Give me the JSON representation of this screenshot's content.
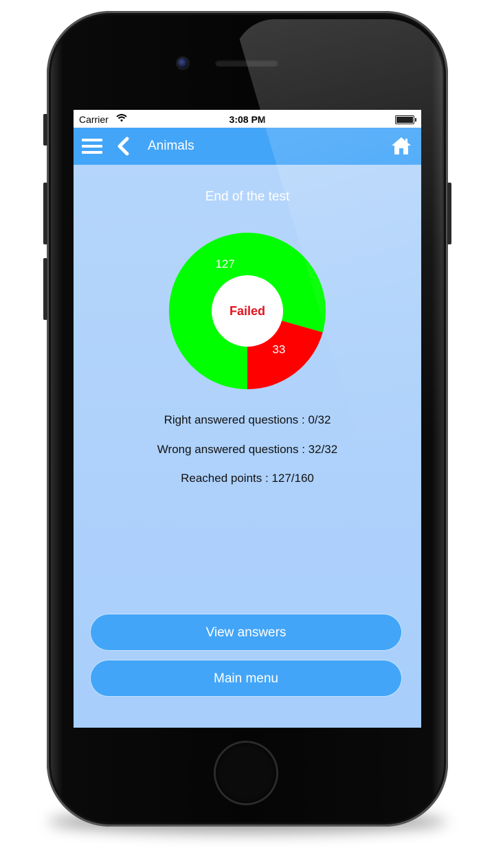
{
  "status_bar": {
    "carrier": "Carrier",
    "time": "3:08 PM"
  },
  "nav": {
    "title": "Animals",
    "icons": [
      "menu-icon",
      "back-icon",
      "home-icon"
    ]
  },
  "content": {
    "heading": "End of the test",
    "result_label": "Failed",
    "stats": {
      "right": "Right answered questions : 0/32",
      "wrong": "Wrong  answered questions : 32/32",
      "points": "Reached points : 127/160"
    }
  },
  "buttons": {
    "view_answers": "View answers",
    "main_menu": "Main menu"
  },
  "chart_data": {
    "type": "pie",
    "categories": [
      "127",
      "33"
    ],
    "values": [
      127,
      33
    ],
    "colors": [
      "#00ff00",
      "#ff0000"
    ],
    "center_label": "Failed"
  },
  "colors": {
    "nav_bar": "#43a5f8",
    "screen_background": "#b6d6fb",
    "button": "#43a5f8",
    "failed_text": "#e1141e"
  }
}
